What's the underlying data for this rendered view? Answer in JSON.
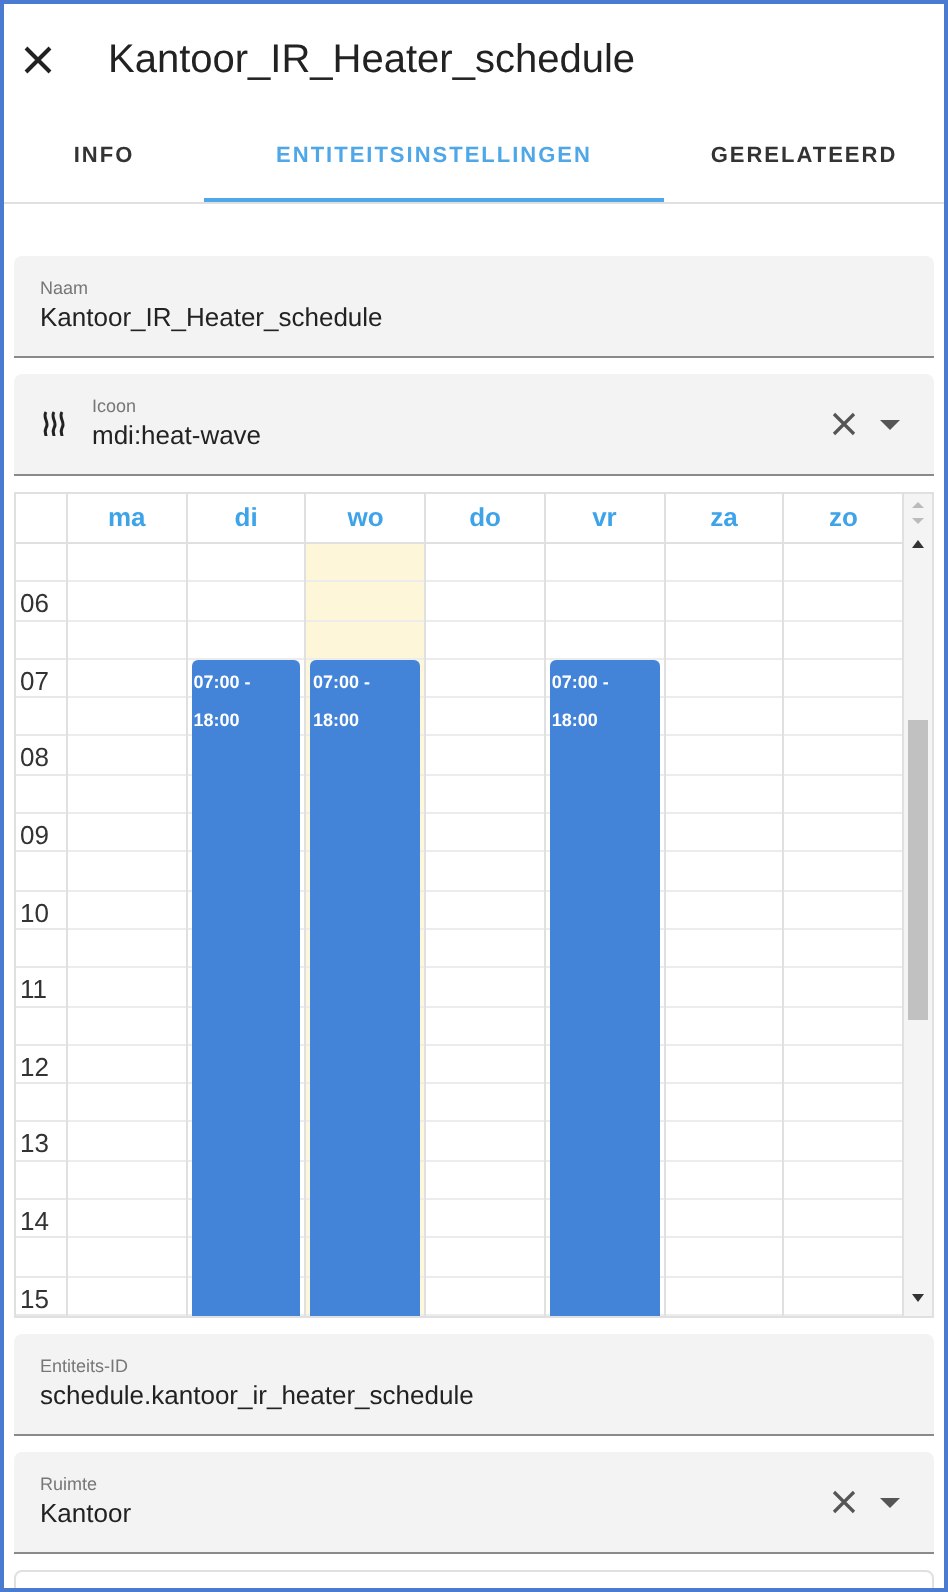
{
  "dialog": {
    "title": "Kantoor_IR_Heater_schedule"
  },
  "tabs": [
    {
      "label": "INFO",
      "selected": false
    },
    {
      "label": "ENTITEITSINSTELLINGEN",
      "selected": true
    },
    {
      "label": "GERELATEERD",
      "selected": false
    }
  ],
  "name_field": {
    "label": "Naam",
    "value": "Kantoor_IR_Heater_schedule"
  },
  "icon_field": {
    "label": "Icoon",
    "value": "mdi:heat-wave"
  },
  "schedule": {
    "days": [
      {
        "label": "ma",
        "today": false
      },
      {
        "label": "di",
        "today": false,
        "events": [
          {
            "label": "07:00 - 18:00"
          }
        ]
      },
      {
        "label": "wo",
        "today": true,
        "events": [
          {
            "label": "07:00 - 18:00"
          }
        ]
      },
      {
        "label": "do",
        "today": false
      },
      {
        "label": "vr",
        "today": false,
        "events": [
          {
            "label": "07:00 - 18:00"
          }
        ]
      },
      {
        "label": "za",
        "today": false
      },
      {
        "label": "zo",
        "today": false
      }
    ],
    "hours": [
      "06",
      "07",
      "08",
      "09",
      "10",
      "11",
      "12",
      "13",
      "14",
      "15"
    ]
  },
  "entity_id_field": {
    "label": "Entiteits-ID",
    "value": "schedule.kantoor_ir_heater_schedule"
  },
  "area_field": {
    "label": "Ruimte",
    "value": "Kantoor"
  }
}
